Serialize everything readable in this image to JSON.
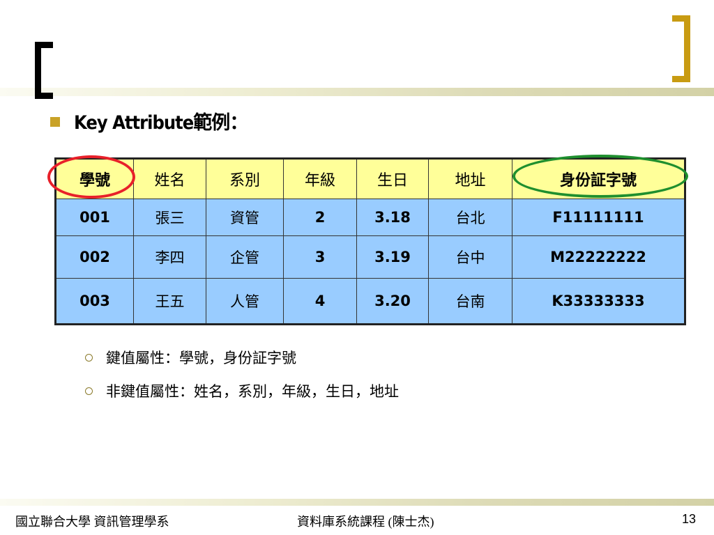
{
  "slide": {
    "heading": "Key Attribute範例：",
    "table": {
      "headers": [
        "學號",
        "姓名",
        "系別",
        "年級",
        "生日",
        "地址",
        "身份証字號"
      ],
      "rows": [
        [
          "001",
          "張三",
          "資管",
          "2",
          "3.18",
          "台北",
          "F11111111"
        ],
        [
          "002",
          "李四",
          "企管",
          "3",
          "3.19",
          "台中",
          "M22222222"
        ],
        [
          "003",
          "王五",
          "人管",
          "4",
          "3.20",
          "台南",
          "K33333333"
        ]
      ]
    },
    "bullets": [
      "鍵值屬性：學號，身份証字號",
      "非鍵值屬性：姓名，系別，年級，生日，地址"
    ]
  },
  "footer": {
    "left": "國立聯合大學 資訊管理學系",
    "center": "資料庫系統課程 (陳士杰)",
    "page_number": "13"
  },
  "colors": {
    "header_row": "#ffff99",
    "data_rows": "#99ccff",
    "primary_key_highlight": "#e8202a",
    "candidate_key_highlight": "#1f8f2e"
  }
}
